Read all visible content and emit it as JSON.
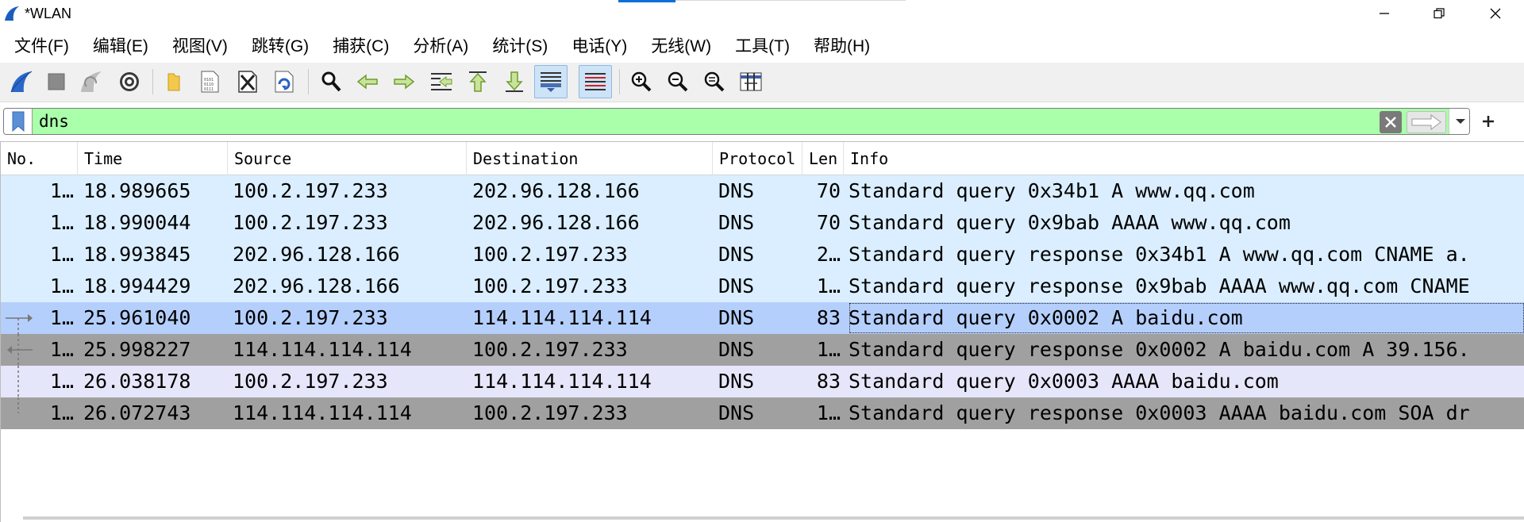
{
  "window": {
    "title": "*WLAN",
    "controls": [
      "minimize",
      "restore",
      "close"
    ]
  },
  "menu": [
    "文件(F)",
    "编辑(E)",
    "视图(V)",
    "跳转(G)",
    "捕获(C)",
    "分析(A)",
    "统计(S)",
    "电话(Y)",
    "无线(W)",
    "工具(T)",
    "帮助(H)"
  ],
  "toolbar": {
    "icons": [
      "shark-fin-start-icon",
      "stop-square-icon",
      "restart-fin-icon",
      "capture-options-gear-icon",
      "open-folder-icon",
      "file-binary-icon",
      "close-file-icon",
      "reload-icon",
      "find-magnifier-icon",
      "back-arrow-icon",
      "forward-arrow-icon",
      "go-to-packet-icon",
      "first-packet-icon",
      "last-packet-icon",
      "autoscroll-icon",
      "colorize-icon",
      "zoom-in-icon",
      "zoom-out-icon",
      "zoom-normal-icon",
      "resize-columns-icon"
    ],
    "active": [
      "autoscroll-icon",
      "colorize-icon"
    ]
  },
  "filter": {
    "value": "dns",
    "background": "#aaffaa",
    "add_label": "+"
  },
  "columns": {
    "no": "No.",
    "time": "Time",
    "source": "Source",
    "destination": "Destination",
    "protocol": "Protocol",
    "len": "Len",
    "info": "Info"
  },
  "rows": [
    {
      "no": "1…",
      "time": "18.989665",
      "source": "100.2.197.233",
      "destination": "202.96.128.166",
      "protocol": "DNS",
      "len": "70",
      "info": "Standard query 0x34b1 A www.qq.com",
      "bg": "#daeeff",
      "selected": false
    },
    {
      "no": "1…",
      "time": "18.990044",
      "source": "100.2.197.233",
      "destination": "202.96.128.166",
      "protocol": "DNS",
      "len": "70",
      "info": "Standard query 0x9bab AAAA www.qq.com",
      "bg": "#daeeff",
      "selected": false
    },
    {
      "no": "1…",
      "time": "18.993845",
      "source": "202.96.128.166",
      "destination": "100.2.197.233",
      "protocol": "DNS",
      "len": "2…",
      "info": "Standard query response 0x34b1 A www.qq.com CNAME a.",
      "bg": "#daeeff",
      "selected": false
    },
    {
      "no": "1…",
      "time": "18.994429",
      "source": "202.96.128.166",
      "destination": "100.2.197.233",
      "protocol": "DNS",
      "len": "1…",
      "info": "Standard query response 0x9bab AAAA www.qq.com CNAME",
      "bg": "#daeeff",
      "selected": false
    },
    {
      "no": "1…",
      "time": "25.961040",
      "source": "100.2.197.233",
      "destination": "114.114.114.114",
      "protocol": "DNS",
      "len": "83",
      "info": "Standard query 0x0002 A baidu.com",
      "bg": "#b5cffc",
      "selected": true
    },
    {
      "no": "1…",
      "time": "25.998227",
      "source": "114.114.114.114",
      "destination": "100.2.197.233",
      "protocol": "DNS",
      "len": "1…",
      "info": "Standard query response 0x0002 A baidu.com A 39.156.",
      "bg": "#a0a0a0",
      "selected": false
    },
    {
      "no": "1…",
      "time": "26.038178",
      "source": "100.2.197.233",
      "destination": "114.114.114.114",
      "protocol": "DNS",
      "len": "83",
      "info": "Standard query 0x0003 AAAA baidu.com",
      "bg": "#e6e6fa",
      "selected": false
    },
    {
      "no": "1…",
      "time": "26.072743",
      "source": "114.114.114.114",
      "destination": "100.2.197.233",
      "protocol": "DNS",
      "len": "1…",
      "info": "Standard query response 0x0003 AAAA baidu.com SOA dr",
      "bg": "#a0a0a0",
      "selected": false
    }
  ]
}
